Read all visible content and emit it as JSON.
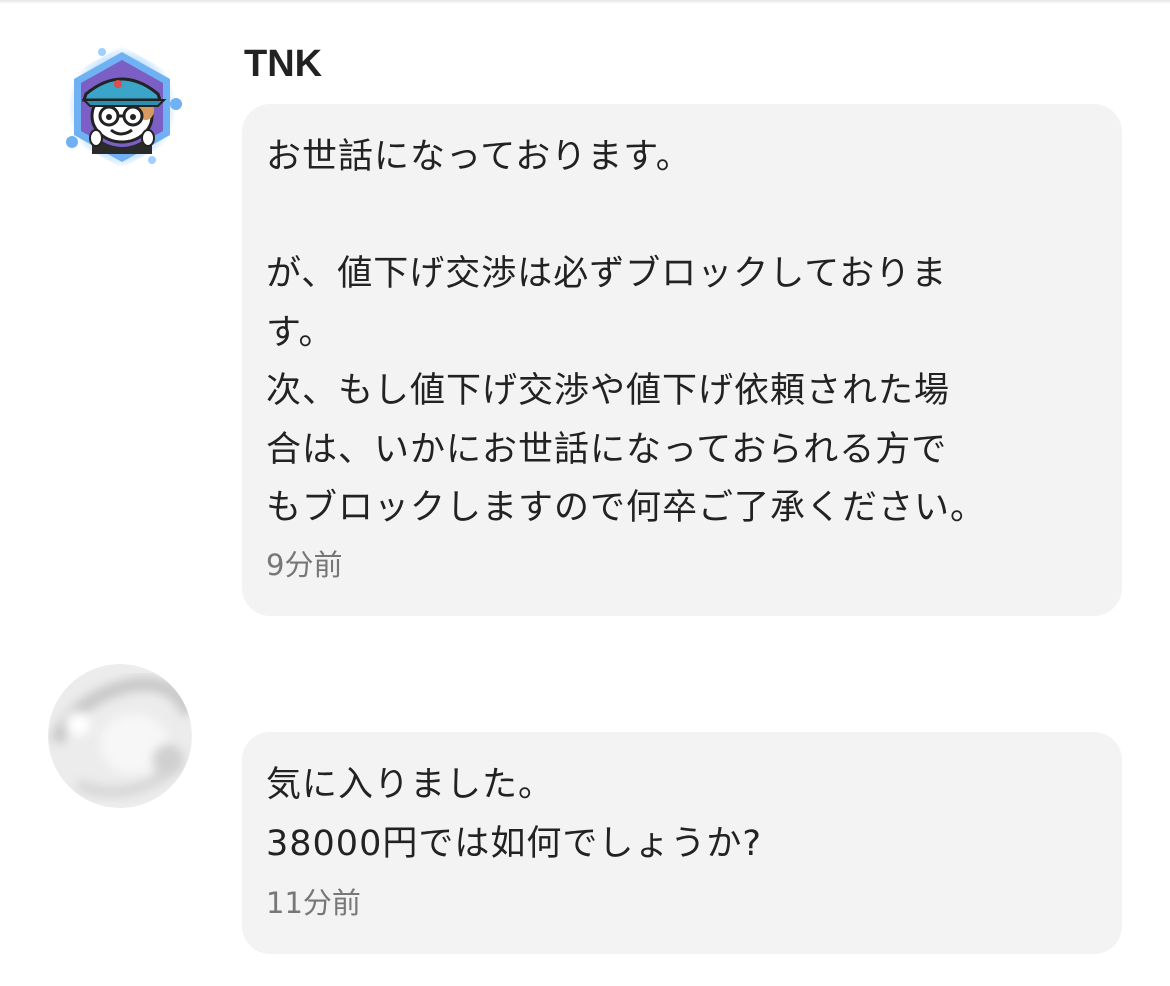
{
  "messages": [
    {
      "sender": "TNK",
      "avatar": "cartoon-panda-cap-avatar",
      "text": "お世話になっております。\n\nが、値下げ交渉は必ずブロックしておりま\nす。\n次、もし値下げ交渉や値下げ依頼された場\n合は、いかにお世話になっておられる方で\nもブロックしますので何卒ご了承ください。",
      "time": "9分前"
    },
    {
      "sender": "",
      "avatar": "blurred-gray-avatar",
      "text": "気に入りました。\n38000円では如何でしょうか?",
      "time": "11分前"
    }
  ],
  "colors": {
    "bubble": "#f3f3f3",
    "text": "#222222",
    "timestamp": "#777777",
    "avatar_frame": "#6fb1f2",
    "avatar_bg": "#7b5fc4"
  }
}
